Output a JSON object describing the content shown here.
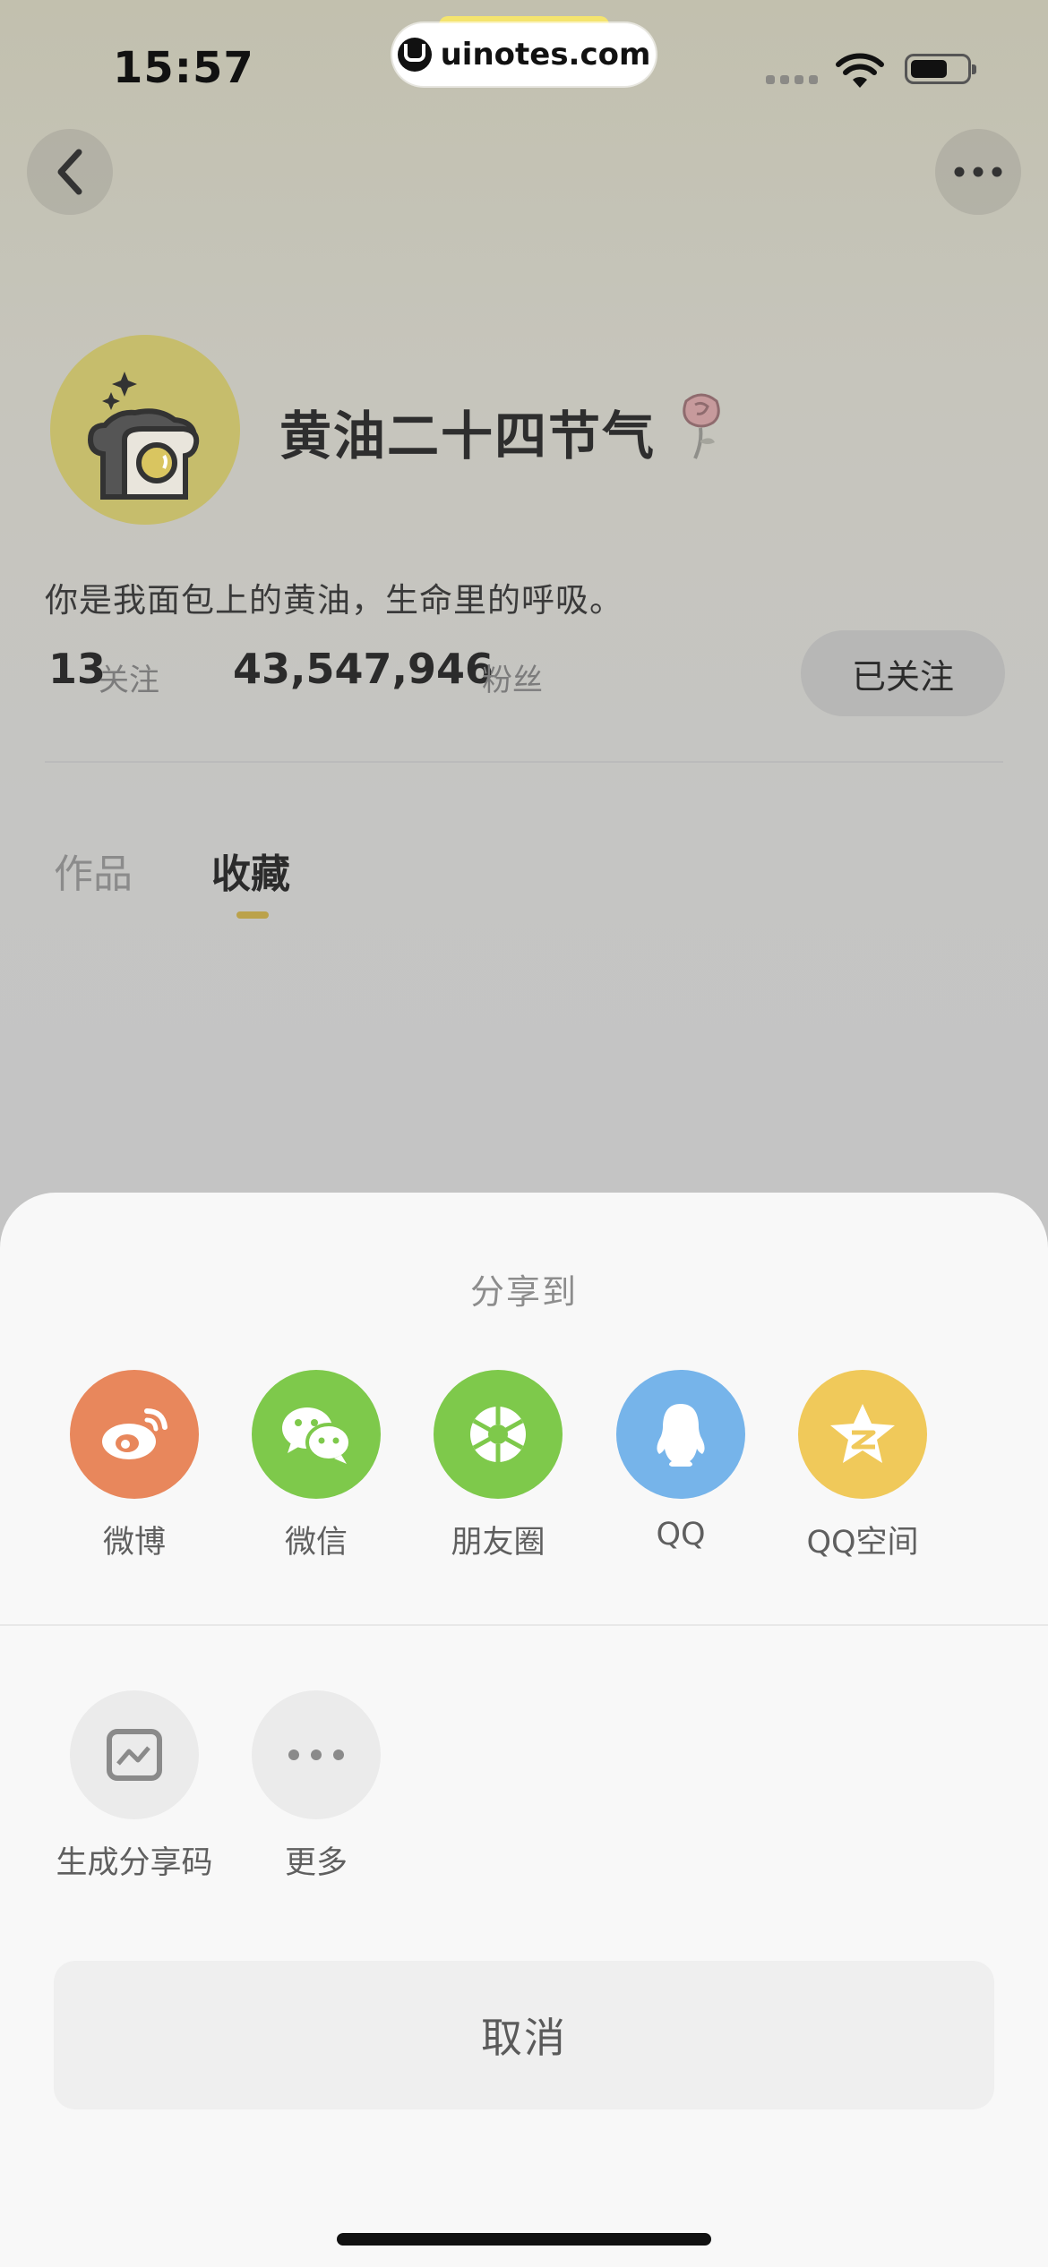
{
  "status_bar": {
    "time": "15:57",
    "watermark": "uinotes.com"
  },
  "nav": {
    "back_icon": "chevron-left-icon",
    "more_icon": "more-horizontal-icon"
  },
  "profile": {
    "name": "黄油二十四节气",
    "bio": "你是我面包上的黄油，生命里的呼吸。",
    "following_count": "13",
    "following_label": "关注",
    "followers_count": "43,547,946",
    "followers_label": "粉丝",
    "follow_button": "已关注"
  },
  "tabs": [
    {
      "label": "作品",
      "active": false
    },
    {
      "label": "收藏",
      "active": true
    }
  ],
  "share_sheet": {
    "title": "分享到",
    "targets": [
      {
        "label": "微博",
        "icon": "weibo-icon",
        "color": "#e8875c"
      },
      {
        "label": "微信",
        "icon": "wechat-icon",
        "color": "#7ec94b"
      },
      {
        "label": "朋友圈",
        "icon": "moments-icon",
        "color": "#7ec94b"
      },
      {
        "label": "QQ",
        "icon": "qq-icon",
        "color": "#76b4ea"
      },
      {
        "label": "QQ空间",
        "icon": "qzone-icon",
        "color": "#f0c95a"
      }
    ],
    "actions": [
      {
        "label": "生成分享码",
        "icon": "image-card-icon"
      },
      {
        "label": "更多",
        "icon": "more-horizontal-icon"
      }
    ],
    "cancel": "取消"
  }
}
